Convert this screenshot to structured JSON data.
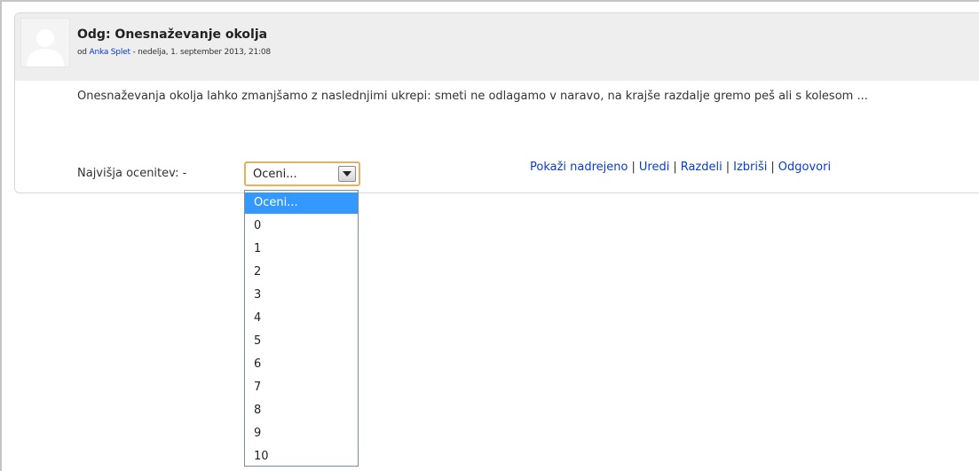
{
  "post": {
    "subject": "Odg: Onesnaževanje okolja",
    "byline_prefix": "od",
    "author": "Anka Splet",
    "byline_suffix": "- nedelja, 1. september 2013, 21:08",
    "body": "Onesnaževanja okolja lahko zmanjšamo z naslednjimi ukrepi: smeti ne odlagamo v naravo,  na krajše razdalje gremo peš ali s kolesom ..."
  },
  "rating": {
    "label": "Najvišja ocenitev: -",
    "selected": "Oceni...",
    "options": [
      "Oceni...",
      "0",
      "1",
      "2",
      "3",
      "4",
      "5",
      "6",
      "7",
      "8",
      "9",
      "10"
    ],
    "highlighted_index": 0,
    "highlight_color": "#3399ff"
  },
  "actions": {
    "show_parent": "Pokaži nadrejeno",
    "edit": "Uredi",
    "split": "Razdeli",
    "delete": "Izbriši",
    "reply": "Odgovori",
    "separator": "|"
  },
  "colors": {
    "link": "#0a3bcf",
    "header_bg": "#eeeeee",
    "select_focus_border": "#e3b25e"
  },
  "icons": {
    "avatar": "user-avatar-icon",
    "dropdown_arrow": "chevron-down-icon"
  }
}
